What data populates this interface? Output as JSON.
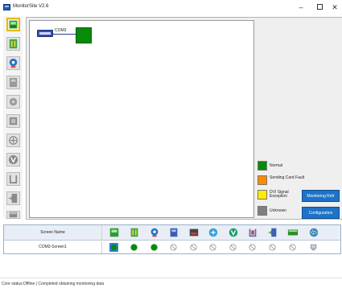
{
  "window": {
    "title": "MonitorSite V2.6",
    "minimize_glyph": "–",
    "close_glyph": "✕"
  },
  "toolbar": {
    "items": [
      {
        "icon": "monitor-card-icon",
        "active": true
      },
      {
        "icon": "receiving-card-icon"
      },
      {
        "icon": "brightness-sensor-icon"
      },
      {
        "icon": "fan-board-icon"
      },
      {
        "icon": "smoke-sensor-icon"
      },
      {
        "icon": "temperature-icon"
      },
      {
        "icon": "fan-icon"
      },
      {
        "icon": "voltage-icon"
      },
      {
        "icon": "humidity-icon"
      },
      {
        "icon": "door-icon"
      },
      {
        "icon": "cabinet-icon"
      }
    ]
  },
  "canvas": {
    "card_label": "COM3"
  },
  "legend": {
    "items": [
      {
        "label": "Normal",
        "color": "#0a8a0a"
      },
      {
        "label": "Sending Card Fault",
        "color": "#ff8c00"
      },
      {
        "label": "DVI Signal Exception",
        "color": "#ffee00"
      },
      {
        "label": "Unknown",
        "color": "#808080"
      }
    ]
  },
  "buttons": {
    "monitoring_refresh": "Monitoring Refr",
    "configuration": "Configuration"
  },
  "table": {
    "header_name": "Screen Name",
    "column_icons": [
      "monitor-card-icon",
      "receiving-card-icon",
      "brightness-sensor-icon",
      "fan-board-icon",
      "smoke-sensor-icon",
      "temperature-icon",
      "fan-icon",
      "voltage-icon",
      "humidity-icon",
      "door-icon",
      "cabinet-icon",
      "globe-icon"
    ],
    "rows": [
      {
        "name": "COM3-Screen1",
        "cells": [
          "blue-dot",
          "green-dot",
          "green-dot",
          "disabled",
          "disabled",
          "disabled",
          "disabled",
          "disabled",
          "disabled",
          "disabled",
          "disabled",
          "monitor-small-icon"
        ]
      }
    ]
  },
  "status": {
    "text": "Core status:Offline  |  Completed obtaining monitoring data"
  }
}
